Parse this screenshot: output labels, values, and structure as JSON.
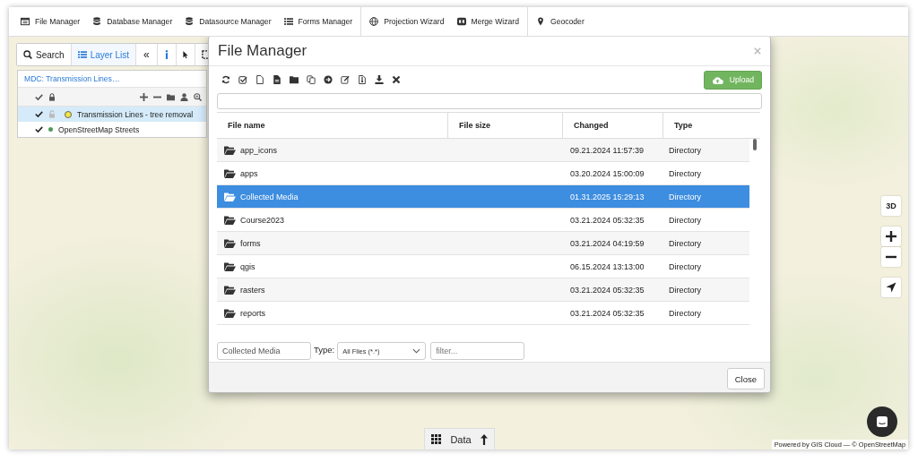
{
  "top_menu": {
    "groups": [
      {
        "items": [
          {
            "kind": "window",
            "label": "File Manager"
          },
          {
            "kind": "database",
            "label": "Database Manager"
          },
          {
            "kind": "database",
            "label": "Datasource Manager"
          },
          {
            "kind": "list",
            "label": "Forms Manager"
          }
        ]
      },
      {
        "items": [
          {
            "kind": "globe",
            "label": "Projection Wizard"
          },
          {
            "kind": "merge",
            "label": "Merge Wizard"
          }
        ]
      },
      {
        "items": [
          {
            "kind": "pin",
            "label": "Geocoder"
          }
        ]
      }
    ]
  },
  "map_toolbar": {
    "buttons": [
      {
        "kind": "search",
        "label": "Search",
        "selected": false
      },
      {
        "kind": "list",
        "label": "Layer List",
        "selected": true
      },
      {
        "kind": "text",
        "label": "«",
        "selected": false
      },
      {
        "kind": "info",
        "selected": false
      },
      {
        "kind": "pointer",
        "selected": false
      },
      {
        "kind": "box-select",
        "selected": false
      }
    ]
  },
  "layer_panel": {
    "title": "MDC: Transmission Lines…",
    "layers": [
      {
        "kind": "vector",
        "name": "Transmission Lines - tree removal",
        "visible": true,
        "selected": true,
        "color": "#f2e640"
      },
      {
        "kind": "basemap",
        "name": "OpenStreetMap Streets",
        "visible": true,
        "selected": false,
        "color": "#4f9a5a"
      }
    ]
  },
  "dialog": {
    "title": "File Manager",
    "upload_label": "Upload",
    "columns": [
      "File name",
      "File size",
      "Changed",
      "Type"
    ],
    "rows": [
      {
        "name": "app_icons",
        "changed": "09.21.2024 11:57:39",
        "type": "Directory",
        "selected": false
      },
      {
        "name": "apps",
        "changed": "03.20.2024 15:00:09",
        "type": "Directory",
        "selected": false
      },
      {
        "name": "Collected Media",
        "changed": "01.31.2025 15:29:13",
        "type": "Directory",
        "selected": true
      },
      {
        "name": "Course2023",
        "changed": "03.21.2024 05:32:35",
        "type": "Directory",
        "selected": false
      },
      {
        "name": "forms",
        "changed": "03.21.2024 04:19:59",
        "type": "Directory",
        "selected": false
      },
      {
        "name": "qgis",
        "changed": "06.15.2024 13:13:00",
        "type": "Directory",
        "selected": false
      },
      {
        "name": "rasters",
        "changed": "03.21.2024 05:32:35",
        "type": "Directory",
        "selected": false
      },
      {
        "name": "reports",
        "changed": "03.21.2024 05:32:35",
        "type": "Directory",
        "selected": false
      }
    ],
    "path": "Collected Media",
    "type_label": "Type:",
    "type_value": "All Files (*.*)",
    "filter_placeholder": "filter...",
    "close_label": "Close"
  },
  "map_controls": {
    "view_label": "3D"
  },
  "data_panel": {
    "label": "Data"
  },
  "attribution": "Powered by GIS Cloud — © OpenStreetMap"
}
